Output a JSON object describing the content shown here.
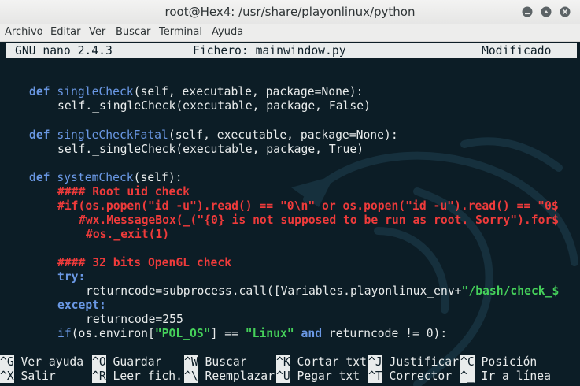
{
  "window": {
    "title": "root@Hex4: /usr/share/playonlinux/python"
  },
  "menubar": {
    "items": [
      "Archivo",
      "Editar",
      "Ver",
      "Buscar",
      "Terminal",
      "Ayuda"
    ]
  },
  "nano": {
    "version": "GNU nano 2.4.3",
    "file": "Fichero: mainwindow.py",
    "status": "Modificado"
  },
  "code_lines": {
    "l1_def": "def",
    "l1_name": "singleCheck",
    "l1_rest": "(self, executable, package=None):",
    "l2": "self._singleCheck(executable, package, False)",
    "l3_def": "def",
    "l3_name": "singleCheckFatal",
    "l3_rest": "(self, executable, package=None):",
    "l4": "self._singleCheck(executable, package, True)",
    "l5_def": "def",
    "l5_name": "systemCheck",
    "l5_rest": "(self):",
    "l6": "#### Root uid check",
    "l7": "#if(os.popen(\"id -u\").read() == \"0\\n\" or os.popen(\"id -u\").read() == \"0$",
    "l8": "#wx.MessageBox(_(\"{0} is not supposed to be run as root. Sorry\").for$",
    "l9": "#os._exit(1)",
    "l10": "#### 32 bits OpenGL check",
    "l11": "try:",
    "l12_a": "returncode=subprocess.call([Variables.playonlinux_env+",
    "l12_b": "\"/bash/check_$",
    "l13": "except:",
    "l14": "returncode=255",
    "l15_a": "if",
    "l15_b": "(os.environ[",
    "l15_c": "\"POL_OS\"",
    "l15_d": "] == ",
    "l15_e": "\"Linux\"",
    "l15_f": " and ",
    "l15_g": "returncode != 0):"
  },
  "shortcuts": {
    "row1": [
      {
        "key": "^G",
        "label": "Ver ayuda"
      },
      {
        "key": "^O",
        "label": "Guardar"
      },
      {
        "key": "^W",
        "label": "Buscar"
      },
      {
        "key": "^K",
        "label": "Cortar txt"
      },
      {
        "key": "^J",
        "label": "Justificar"
      },
      {
        "key": "^C",
        "label": "Posición"
      }
    ],
    "row2": [
      {
        "key": "^X",
        "label": "Salir"
      },
      {
        "key": "^R",
        "label": "Leer fich."
      },
      {
        "key": "^\\",
        "label": "Reemplazar"
      },
      {
        "key": "^U",
        "label": "Pegar txt"
      },
      {
        "key": "^T",
        "label": "Corrector"
      },
      {
        "key": "^_",
        "label": "Ir a línea"
      }
    ]
  },
  "colors": {
    "background": "#0c1d26",
    "keyword": "#6a98e4",
    "comment": "#ef3b3b",
    "string": "#45d05a"
  }
}
